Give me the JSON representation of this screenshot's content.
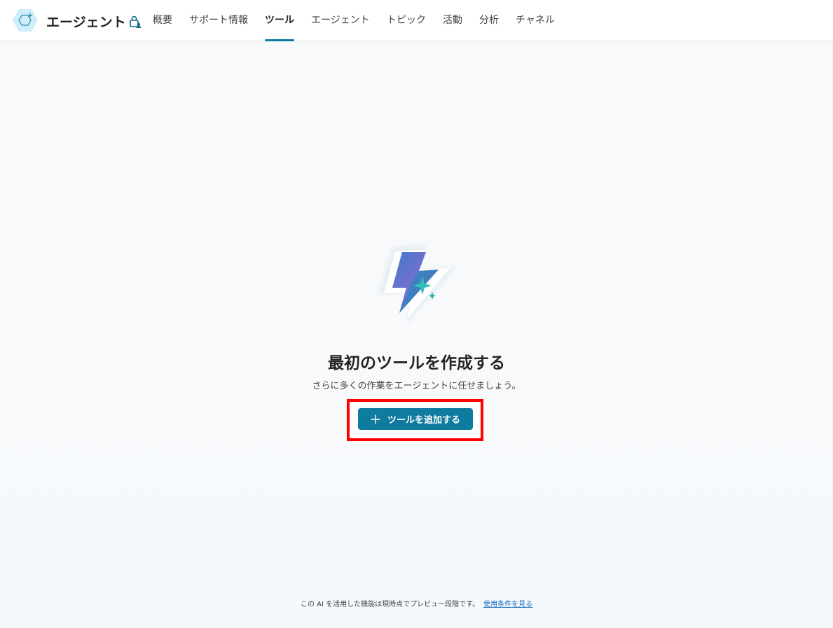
{
  "header": {
    "agent_name": "エージェント",
    "logo_icon": "agent-hexagon-icon",
    "lock_icon": "lock-person-icon",
    "tabs": [
      {
        "label": "概要",
        "active": false
      },
      {
        "label": "サポート情報",
        "active": false
      },
      {
        "label": "ツール",
        "active": true
      },
      {
        "label": "エージェント",
        "active": false
      },
      {
        "label": "トピック",
        "active": false
      },
      {
        "label": "活動",
        "active": false
      },
      {
        "label": "分析",
        "active": false
      },
      {
        "label": "チャネル",
        "active": false
      }
    ]
  },
  "empty_state": {
    "illustration_icon": "lightning-sparkle-icon",
    "title": "最初のツールを作成する",
    "subtitle": "さらに多くの作業をエージェントに任せましょう。",
    "add_button_label": "ツールを追加する",
    "add_button_icon": "plus-icon"
  },
  "footer": {
    "notice": "この AI を活用した機能は現時点でプレビュー段階です。",
    "terms_link": "使用条件を見る"
  },
  "colors": {
    "accent": "#0f7b9e",
    "highlight_border": "#ff0000",
    "link": "#0f6cbd"
  }
}
